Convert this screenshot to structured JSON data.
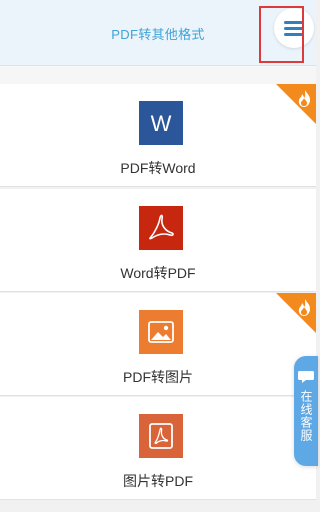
{
  "header": {
    "title": "PDF转其他格式"
  },
  "items": [
    {
      "label": "PDF转Word",
      "icon": "word-icon",
      "hot": true,
      "icon_color": "#2b579a",
      "icon_letter": "W"
    },
    {
      "label": "Word转PDF",
      "icon": "pdf-icon",
      "hot": false,
      "icon_color": "#c7260f"
    },
    {
      "label": "PDF转图片",
      "icon": "image-icon",
      "hot": true,
      "icon_color": "#ec7c2f"
    },
    {
      "label": "图片转PDF",
      "icon": "image-to-pdf-icon",
      "hot": false,
      "icon_color": "#d9643a"
    }
  ],
  "service": {
    "label": "在线客服"
  },
  "colors": {
    "accent": "#3fa3d6",
    "menu": "#2f7fc1",
    "hot": "#f28a1e",
    "service": "#5ea8e6",
    "highlight": "#dd3b3b"
  }
}
